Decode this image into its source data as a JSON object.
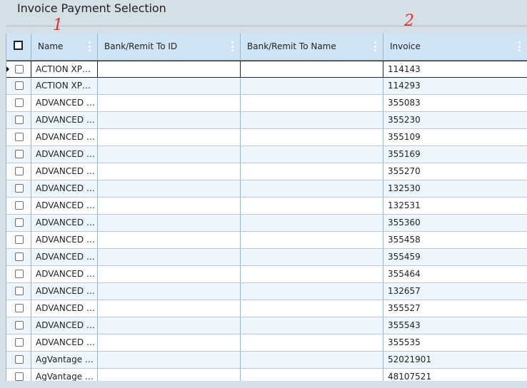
{
  "page": {
    "title": "Invoice Payment Selection"
  },
  "annotations": {
    "mark1": "1",
    "mark2": "2",
    "color": "#e22d2d"
  },
  "table": {
    "columns": [
      {
        "key": "name",
        "label": "Name"
      },
      {
        "key": "bank_id",
        "label": "Bank/Remit To ID"
      },
      {
        "key": "bank_name",
        "label": "Bank/Remit To Name"
      },
      {
        "key": "invoice",
        "label": "Invoice"
      }
    ],
    "rows": [
      {
        "name": "ACTION XP…",
        "bank_id": "",
        "bank_name": "",
        "invoice": "114143",
        "selected": true
      },
      {
        "name": "ACTION XP…",
        "bank_id": "",
        "bank_name": "",
        "invoice": "114293"
      },
      {
        "name": "ADVANCED …",
        "bank_id": "",
        "bank_name": "",
        "invoice": "355083"
      },
      {
        "name": "ADVANCED …",
        "bank_id": "",
        "bank_name": "",
        "invoice": "355230"
      },
      {
        "name": "ADVANCED …",
        "bank_id": "",
        "bank_name": "",
        "invoice": "355109"
      },
      {
        "name": "ADVANCED …",
        "bank_id": "",
        "bank_name": "",
        "invoice": "355169"
      },
      {
        "name": "ADVANCED …",
        "bank_id": "",
        "bank_name": "",
        "invoice": "355270"
      },
      {
        "name": "ADVANCED …",
        "bank_id": "",
        "bank_name": "",
        "invoice": "132530"
      },
      {
        "name": "ADVANCED …",
        "bank_id": "",
        "bank_name": "",
        "invoice": "132531"
      },
      {
        "name": "ADVANCED …",
        "bank_id": "",
        "bank_name": "",
        "invoice": "355360"
      },
      {
        "name": "ADVANCED …",
        "bank_id": "",
        "bank_name": "",
        "invoice": "355458"
      },
      {
        "name": "ADVANCED …",
        "bank_id": "",
        "bank_name": "",
        "invoice": "355459"
      },
      {
        "name": "ADVANCED …",
        "bank_id": "",
        "bank_name": "",
        "invoice": "355464"
      },
      {
        "name": "ADVANCED …",
        "bank_id": "",
        "bank_name": "",
        "invoice": "132657"
      },
      {
        "name": "ADVANCED …",
        "bank_id": "",
        "bank_name": "",
        "invoice": "355527"
      },
      {
        "name": "ADVANCED …",
        "bank_id": "",
        "bank_name": "",
        "invoice": "355543"
      },
      {
        "name": "ADVANCED …",
        "bank_id": "",
        "bank_name": "",
        "invoice": "355535"
      },
      {
        "name": "AgVantage …",
        "bank_id": "",
        "bank_name": "",
        "invoice": "52021901"
      },
      {
        "name": "AgVantage …",
        "bank_id": "",
        "bank_name": "",
        "invoice": "48107521"
      }
    ]
  },
  "icons": {
    "header_checkbox": "checkbox-icon",
    "column_menu": "kebab-menu-icon",
    "row_marker": "current-row-triangle-icon"
  }
}
